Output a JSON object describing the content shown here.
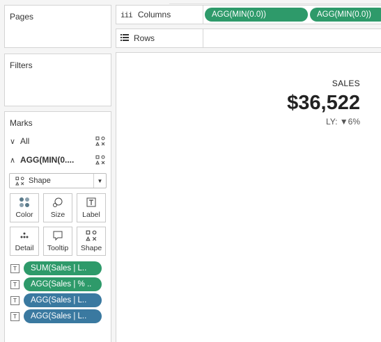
{
  "pages": {
    "title": "Pages"
  },
  "filters": {
    "title": "Filters"
  },
  "columns": {
    "label": "Columns",
    "pills": [
      "AGG(MIN(0.0))",
      "AGG(MIN(0.0))"
    ]
  },
  "rows": {
    "label": "Rows"
  },
  "marks": {
    "title": "Marks",
    "all_label": "All",
    "layer_label": "AGG(MIN(0....",
    "mark_type": "Shape",
    "cards": [
      "Color",
      "Size",
      "Label",
      "Detail",
      "Tooltip",
      "Shape"
    ],
    "fields": [
      {
        "label": "SUM(Sales | L..",
        "color": "#2e9a6a"
      },
      {
        "label": "AGG(Sales | % ..",
        "color": "#2e9a6a"
      },
      {
        "label": "AGG(Sales | L..",
        "color": "#3a79a0"
      },
      {
        "label": "AGG(Sales | L..",
        "color": "#3a79a0"
      }
    ]
  },
  "view": {
    "kpi_title": "SALES",
    "kpi_value": "$36,522",
    "kpi_sub": "LY: ▼6%"
  }
}
